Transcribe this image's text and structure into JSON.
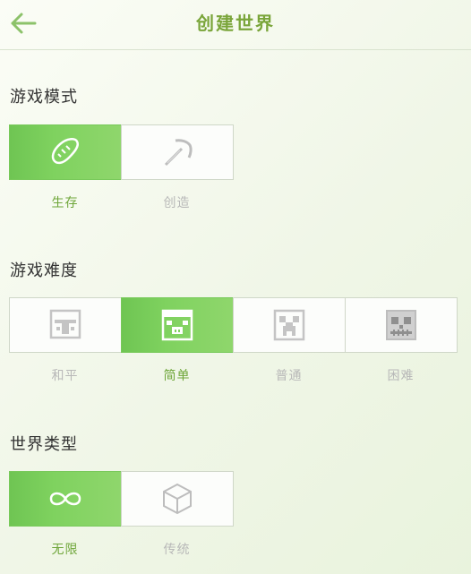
{
  "header": {
    "title": "创建世界"
  },
  "sections": [
    {
      "title": "游戏模式",
      "options": [
        {
          "label": "生存",
          "icon": "bread-icon",
          "selected": true
        },
        {
          "label": "创造",
          "icon": "pickaxe-icon",
          "selected": false
        }
      ]
    },
    {
      "title": "游戏难度",
      "options": [
        {
          "label": "和平",
          "icon": "villager-face-icon",
          "selected": false
        },
        {
          "label": "简单",
          "icon": "pig-face-icon",
          "selected": true
        },
        {
          "label": "普通",
          "icon": "creeper-face-icon",
          "selected": false
        },
        {
          "label": "困难",
          "icon": "skeleton-face-icon",
          "selected": false
        }
      ]
    },
    {
      "title": "世界类型",
      "options": [
        {
          "label": "无限",
          "icon": "infinity-icon",
          "selected": true
        },
        {
          "label": "传统",
          "icon": "cube-icon",
          "selected": false
        }
      ]
    }
  ],
  "colors": {
    "accent": "#6fc553",
    "selected_label": "#6fa63a",
    "muted_label": "#b8b8b8",
    "title": "#7aa53a"
  }
}
